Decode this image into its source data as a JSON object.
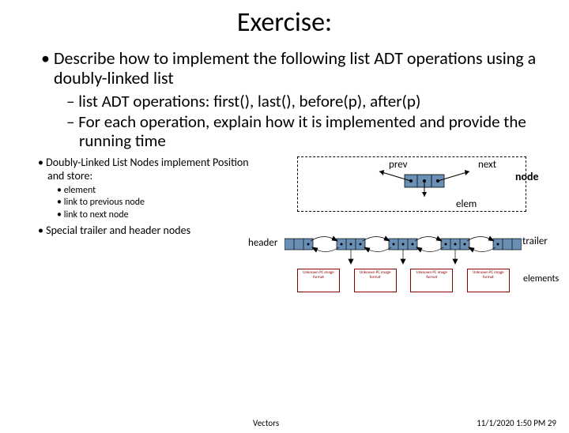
{
  "title": "Exercise:",
  "bullets": {
    "main": "Describe how to implement the following list ADT operations using a doubly-linked list",
    "sub1": "list ADT operations: first(), last(), before(p), after(p)",
    "sub2": "For each operation, explain how it is implemented and provide the running time"
  },
  "lower": {
    "nodes_desc": "Doubly-Linked List Nodes implement Position and store:",
    "store1": "element",
    "store2": "link to previous node",
    "store3": "link to next node",
    "special": "Special trailer and header nodes"
  },
  "diagram": {
    "prev": "prev",
    "next": "next",
    "node": "node",
    "elem": "elem",
    "header": "header",
    "trailer": "trailer",
    "elements": "elements",
    "boxtext": "Unknown PC image format"
  },
  "footer": {
    "center": "Vectors",
    "date": "11/1/2020 1:50 PM",
    "page": "29"
  }
}
